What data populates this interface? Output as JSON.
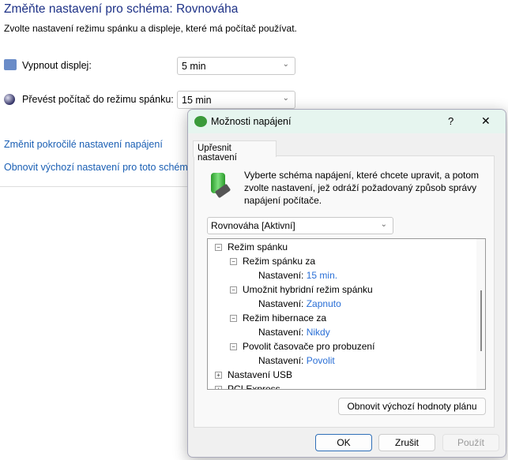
{
  "page": {
    "title": "Změňte nastavení pro schéma: Rovnováha",
    "subtitle": "Zvolte nastavení režimu spánku a displeje, které má počítač používat.",
    "display_off": {
      "label": "Vypnout displej:",
      "value": "5 min"
    },
    "sleep": {
      "label": "Převést počítač do režimu spánku:",
      "value": "15 min"
    },
    "links": [
      "Změnit pokročilé nastavení napájení",
      "Obnovit výchozí nastavení pro toto schéma"
    ]
  },
  "dialog": {
    "title": "Možnosti napájení",
    "help": "?",
    "close": "✕",
    "tab": "Upřesnit nastavení",
    "description": "Vyberte schéma napájení, které chcete upravit, a potom zvolte nastavení, jež odráží požadovaný způsob správy napájení počítače.",
    "scheme": "Rovnováha [Aktivní]",
    "tree": {
      "root": "Režim spánku",
      "setting_label": "Nastavení:",
      "items": [
        {
          "label": "Režim spánku za",
          "value": "15 min."
        },
        {
          "label": "Umožnit hybridní režim spánku",
          "value": "Zapnuto"
        },
        {
          "label": "Režim hibernace za",
          "value": "Nikdy"
        },
        {
          "label": "Povolit časovače pro probuzení",
          "value": "Povolit"
        }
      ],
      "collapsed": [
        "Nastavení USB",
        "PCI Express"
      ]
    },
    "restore": "Obnovit výchozí hodnoty plánu",
    "ok": "OK",
    "cancel": "Zrušit",
    "apply": "Použít"
  }
}
